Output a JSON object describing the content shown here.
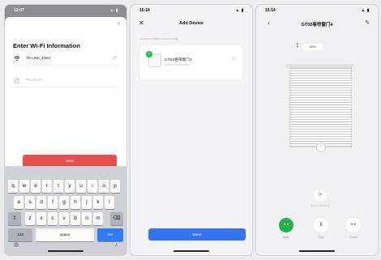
{
  "status_bars": [
    "12:07",
    "16:14",
    "16:14"
  ],
  "status_signal": "▲ ▮",
  "phone1": {
    "title": "Enter Wi-Fi Information",
    "ssid": "TP-LINK_E564",
    "password_placeholder": "Password",
    "next_label": "Next",
    "keyboard": {
      "row1": [
        "q",
        "w",
        "e",
        "r",
        "t",
        "y",
        "u",
        "i",
        "o",
        "p"
      ],
      "row2": [
        "a",
        "s",
        "d",
        "f",
        "g",
        "h",
        "j",
        "k",
        "l"
      ],
      "row3": [
        "z",
        "x",
        "c",
        "v",
        "b",
        "n",
        "m"
      ],
      "shift": "⇧",
      "backspace": "⌫",
      "num": "123",
      "space": "space",
      "go": "Go"
    }
  },
  "phone2": {
    "title": "Add Device",
    "section": "Devices added successfully",
    "device_name": "GT02卷帘窗门4",
    "device_sub": "Added successfully",
    "done_label": "Done"
  },
  "phone3": {
    "title": "GT02卷帘窗门4",
    "percent": "65%",
    "reverse_label": "Motor Direction",
    "controls": [
      {
        "icon": "• •",
        "label": "Open"
      },
      {
        "icon": "‖",
        "label": "Stop"
      },
      {
        "icon": "• •",
        "label": "Close"
      }
    ]
  },
  "colors": {
    "next_button": "#ea4d4d",
    "done_button": "#3576f0",
    "active_control": "#23b04b",
    "success": "#1fbf5b"
  }
}
